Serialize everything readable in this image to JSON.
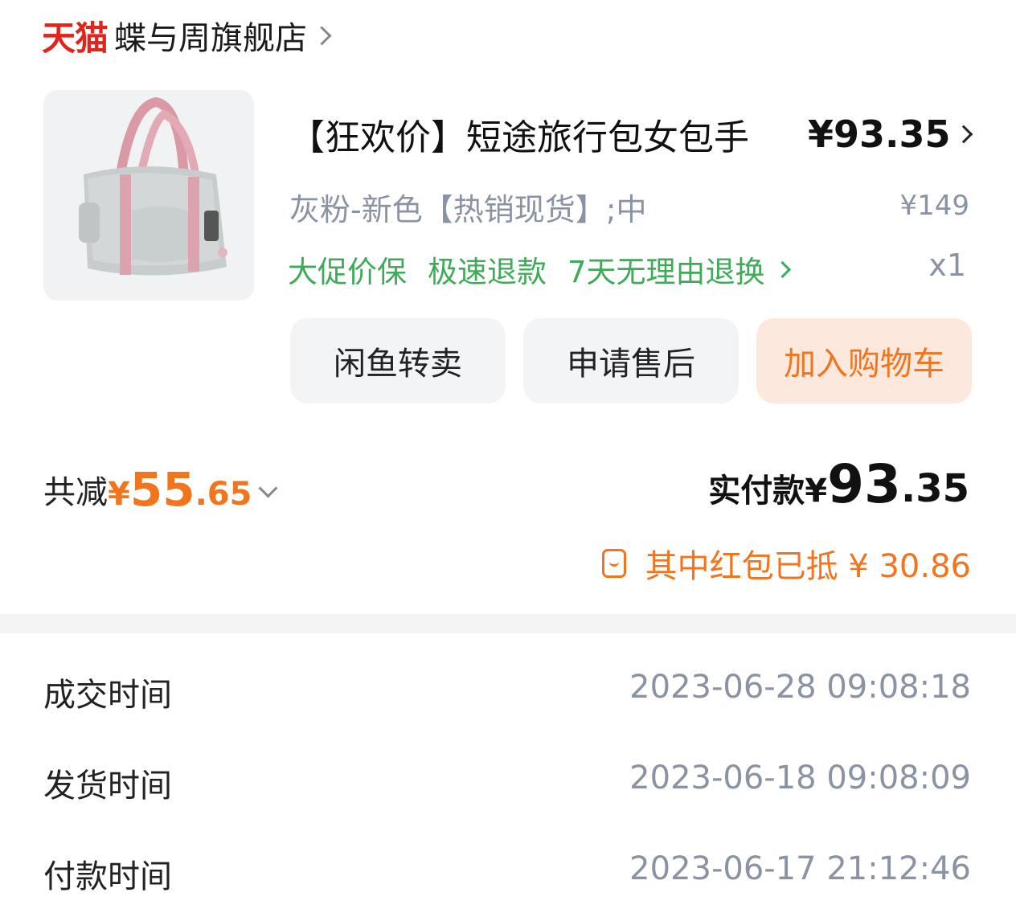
{
  "store": {
    "logo_text": "天猫",
    "name": "蝶与周旗舰店"
  },
  "product": {
    "title": "【狂欢价】短途旅行包女包手",
    "price": "¥93.35",
    "sku": "灰粉-新色【热销现货】;中",
    "original_price": "¥149",
    "services": [
      "大促价保",
      "极速退款",
      "7天无理由退换"
    ],
    "quantity": "x1",
    "image_icon": "pink-gray-travel-bag"
  },
  "actions": {
    "resell": "闲鱼转卖",
    "after_sale": "申请售后",
    "add_cart": "加入购物车"
  },
  "summary": {
    "saved_label": "共减",
    "saved_yen": "¥",
    "saved_int": "55",
    "saved_dec": ".65",
    "paid_label": "实付款¥",
    "paid_int": "93",
    "paid_dec": ".35",
    "redpack_text": "其中红包已抵 ¥ 30.86"
  },
  "order_info": [
    {
      "label": "成交时间",
      "value": "2023-06-28 09:08:18"
    },
    {
      "label": "发货时间",
      "value": "2023-06-18 09:08:09"
    },
    {
      "label": "付款时间",
      "value": "2023-06-17 21:12:46"
    }
  ],
  "colors": {
    "accent_orange": "#f2741c",
    "tmall_red": "#e1251b",
    "service_green": "#3faa58",
    "muted_gray": "#8a93a3"
  }
}
